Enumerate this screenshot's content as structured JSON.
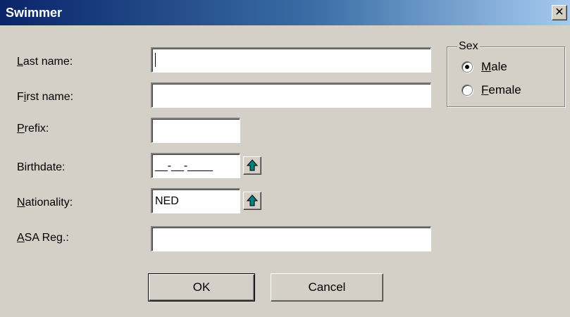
{
  "window": {
    "title": "Swimmer",
    "close_glyph": "✕",
    "title_gradient": [
      "#0a246a",
      "#3a6ea5",
      "#a6caf0"
    ]
  },
  "form": {
    "last_name": {
      "label_mnemonic": "L",
      "label_rest": "ast name:",
      "value": ""
    },
    "first_name": {
      "label_pre": "F",
      "label_mnemonic": "i",
      "label_rest": "rst name:",
      "value": ""
    },
    "prefix": {
      "label_mnemonic": "P",
      "label_rest": "refix:",
      "value": ""
    },
    "birthdate": {
      "label": "Birthdate:",
      "value": "__-__-____"
    },
    "nationality": {
      "label_mnemonic": "N",
      "label_rest": "ationality:",
      "value": "NED"
    },
    "asa_reg": {
      "label_mnemonic": "A",
      "label_rest": "SA Reg.:",
      "value": ""
    }
  },
  "sex_group": {
    "title": "Sex",
    "options": [
      {
        "mnemonic": "M",
        "rest": "ale",
        "selected": true
      },
      {
        "mnemonic": "F",
        "rest": "emale",
        "selected": false
      }
    ]
  },
  "buttons": {
    "ok": "OK",
    "cancel": "Cancel"
  },
  "icons": {
    "lookup": "green-up-arrow-icon",
    "arrow_color": "#008080"
  }
}
